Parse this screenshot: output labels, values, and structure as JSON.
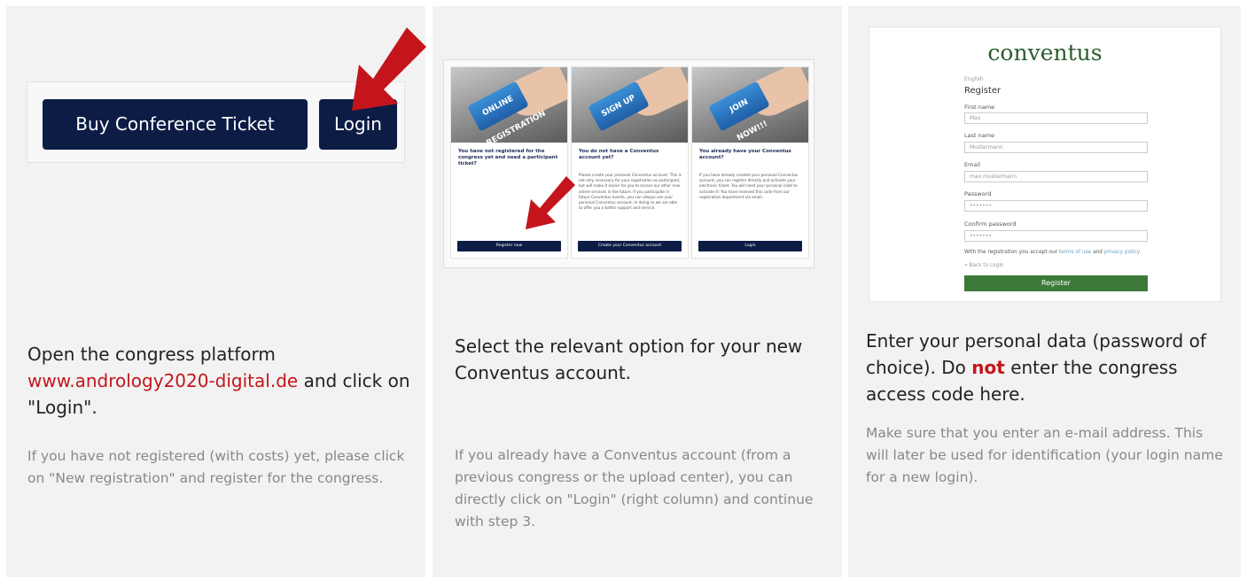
{
  "colors": {
    "navy": "#0c1c45",
    "red_accent": "#c4151c",
    "green": "#3d7a3a",
    "panel_bg": "#f2f2f2"
  },
  "step1": {
    "buy_label": "Buy Conference Ticket",
    "login_label": "Login",
    "text_pre": "Open the congress platform",
    "link": "www.andrology2020-digital.de",
    "text_post": "and click on \"Login\".",
    "note": "If you have not registered (with costs) yet, please click on \"New registration\" and register for the congress."
  },
  "step2": {
    "cards": [
      {
        "key": "ONLINE REGISTRATION",
        "question": "You have not registered for the congress yet and need a participant ticket?",
        "body": "",
        "button": "Register now"
      },
      {
        "key": "SIGN UP",
        "question": "You do not have a Conventus account yet?",
        "body": "Please create your personal Conventus account. This is not only necessary for your registration as participant, but will make it easier for you to access our other new online services in the future. If you participate in future Conventus events, you can always use your personal Conventus account. In doing so we are able to offer you a better support and service.",
        "button": "Create your Conventus account"
      },
      {
        "key": "JOIN NOW!!!",
        "question": "You already have your Conventus account?",
        "body": "If you have already created your personal Conventus account, you can register directly and activate your electronic ticket. You will need your personal code to activate it! You have received this code from our registration department via email.",
        "button": "Login"
      }
    ],
    "text": "Select the relevant option for your new Conventus account.",
    "note": "If you already have a Conventus account (from a previous congress or the upload center), you can directly click on \"Login\" (right column) and continue with step 3."
  },
  "step3": {
    "logo": "conventus",
    "language": "English",
    "heading": "Register",
    "fields": [
      {
        "label": "First name",
        "value": "Max"
      },
      {
        "label": "Last name",
        "value": "Mustermann"
      },
      {
        "label": "Email",
        "value": "max.mustermann"
      },
      {
        "label": "Password",
        "value": "•••••••"
      },
      {
        "label": "Confirm password",
        "value": "•••••••"
      }
    ],
    "terms_pre": "With the registration you accept our",
    "terms_link": "terms of use",
    "terms_mid": "and",
    "privacy_link": "privacy policy.",
    "back": "« Back to Login",
    "register_button": "Register",
    "text_pre": "Enter your personal data (password of choice). Do",
    "text_bold": "not",
    "text_post": "enter the congress access code here.",
    "note": "Make sure that you enter an e-mail address. This will later be used for identification (your login name for a new login)."
  }
}
